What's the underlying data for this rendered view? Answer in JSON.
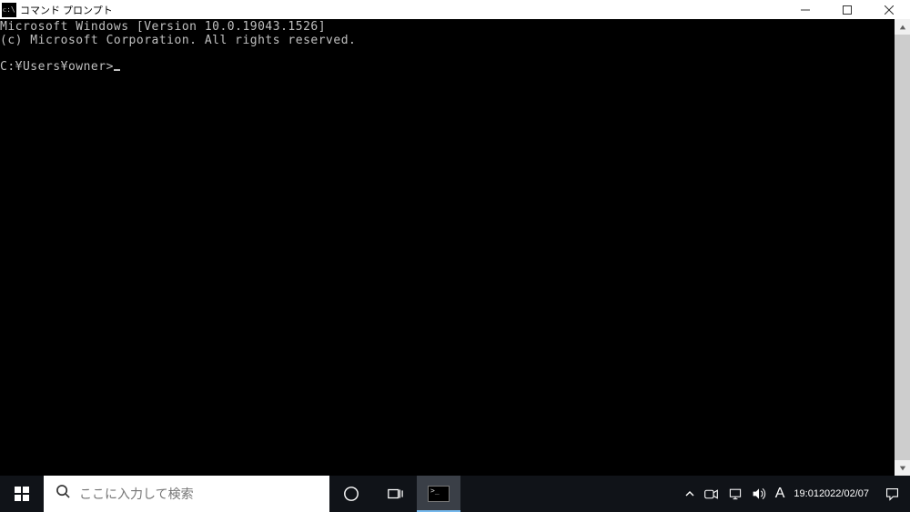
{
  "window": {
    "title": "コマンド プロンプト"
  },
  "console": {
    "line1": "Microsoft Windows [Version 10.0.19043.1526]",
    "line2": "(c) Microsoft Corporation. All rights reserved.",
    "prompt": "C:¥Users¥owner>"
  },
  "taskbar": {
    "search_placeholder": "ここに入力して検索",
    "ime": "A",
    "time": "19:01",
    "date": "2022/02/07"
  }
}
